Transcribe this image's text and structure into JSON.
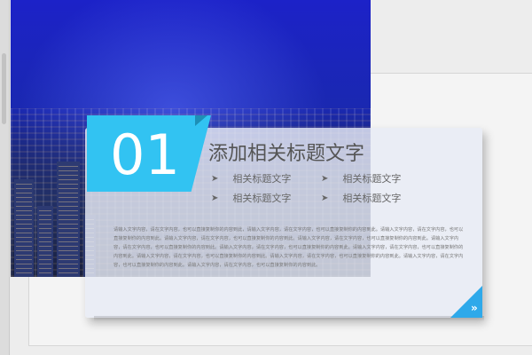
{
  "slide": {
    "number": "01",
    "title": "添加相关标题文字",
    "sub_items": [
      "相关标题文字",
      "相关标题文字",
      "相关标题文字",
      "相关标题文字"
    ],
    "body_text": "请输入文字内容，请在文字内容，也可以直接复制你的内容到此，请输入文字内容，请在文字内容，也可以直接复制你的内容到此。请输入文字内容，请在文字内容，也可以直接复制你的内容到此。请输入文字内容，请在文字内容，也可以直接复制你的内容到此。请输入文字内容，请在文字内容，也可以直接复制你的内容到此。请输入文字内容，请在文字内容，也可以直接复制你的内容到此。请输入文字内容，请在文字内容，也可以直接复制你的内容到此。请输入文字内容，请在文字内容，也可以直接复制你的内容到此。请输入文字内容，请在文字内容，也可以直接复制你的内容到此。请输入文字内容，请在文字内容，也可以直接复制你的内容到此。请输入文字内容，请在文字内容，也可以直接复制你的内容到此。请输入文字内容，请在文字内容，也可以直接复制你的内容到此。",
    "corner_icon": "chevron-right-icon",
    "accent_color": "#32c3f2"
  }
}
